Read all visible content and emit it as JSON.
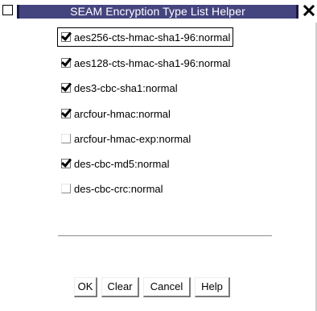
{
  "window": {
    "title": "SEAM Encryption Type List Helper",
    "close_glyph": "✕"
  },
  "options": [
    {
      "label": "aes256-cts-hmac-sha1-96:normal",
      "checked": true,
      "focused": true
    },
    {
      "label": "aes128-cts-hmac-sha1-96:normal",
      "checked": true,
      "focused": false
    },
    {
      "label": "des3-cbc-sha1:normal",
      "checked": true,
      "focused": false
    },
    {
      "label": "arcfour-hmac:normal",
      "checked": true,
      "focused": false
    },
    {
      "label": "arcfour-hmac-exp:normal",
      "checked": false,
      "focused": false
    },
    {
      "label": "des-cbc-md5:normal",
      "checked": true,
      "focused": false
    },
    {
      "label": "des-cbc-crc:normal",
      "checked": false,
      "focused": false
    }
  ],
  "buttons": {
    "ok": "OK",
    "clear": "Clear",
    "cancel": "Cancel",
    "help": "Help"
  },
  "colors": {
    "titlebar": "#44447f",
    "title_text": "#ffffff"
  }
}
